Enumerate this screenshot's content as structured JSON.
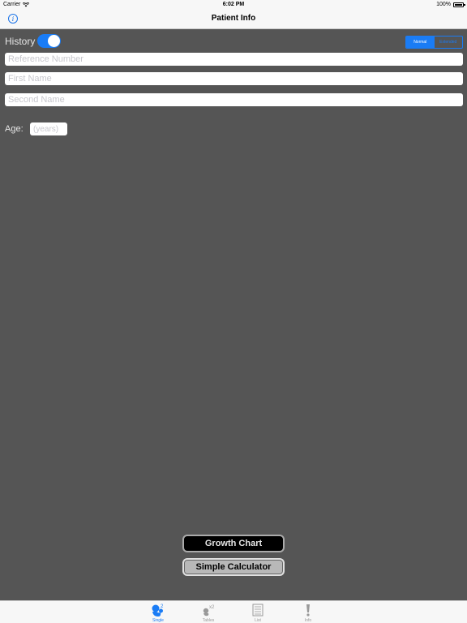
{
  "status_bar": {
    "carrier": "Carrier",
    "time": "6:02 PM",
    "battery": "100%"
  },
  "nav": {
    "title": "Patient Info",
    "info_button": "i"
  },
  "form": {
    "history_label": "History",
    "history_on": true,
    "segments": [
      {
        "label": "Normal",
        "active": true
      },
      {
        "label": "Extended",
        "active": false
      }
    ],
    "reference_placeholder": "Reference Number",
    "first_name_placeholder": "First Name",
    "second_name_placeholder": "Second Name",
    "age_label": "Age:",
    "age_placeholder": "(years)"
  },
  "buttons": {
    "growth_chart": "Growth Chart",
    "simple_calculator": "Simple Calculator"
  },
  "tabs": [
    {
      "label": "Single",
      "icon": "single-icon",
      "active": true
    },
    {
      "label": "Tables",
      "icon": "tables-icon",
      "active": false
    },
    {
      "label": "List",
      "icon": "list-icon",
      "active": false
    },
    {
      "label": "Info",
      "icon": "info-exclamation-icon",
      "active": false
    }
  ],
  "colors": {
    "accent": "#1a7cf5",
    "background": "#555555",
    "bar": "#f7f7f7"
  }
}
